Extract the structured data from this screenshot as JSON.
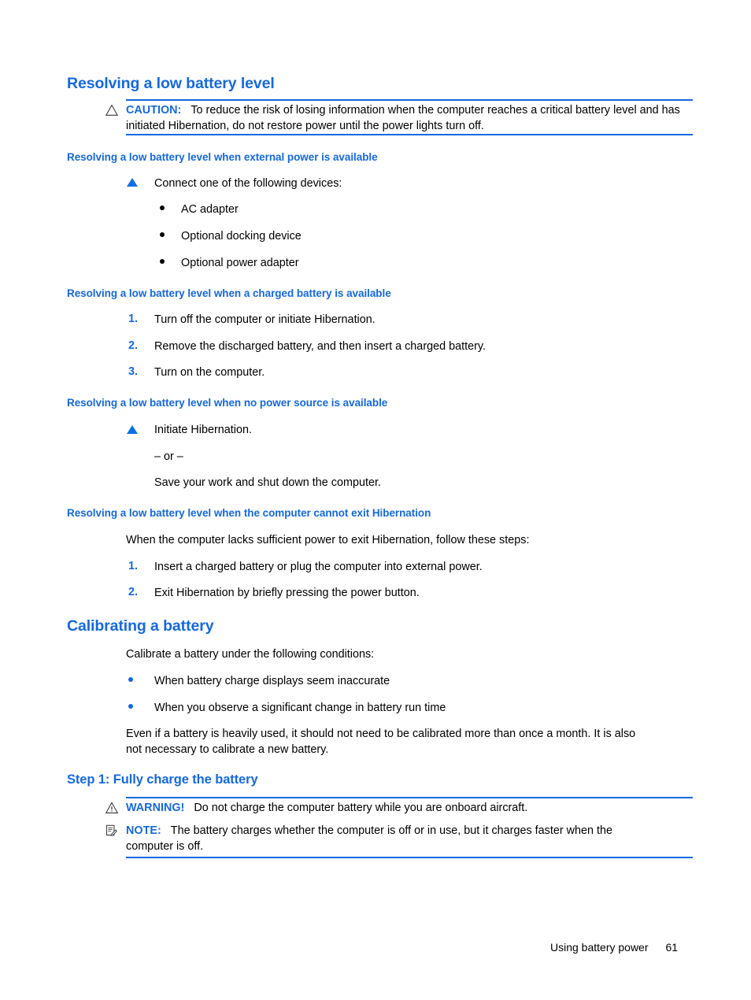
{
  "document": {
    "section_heading": "Resolving a low battery level",
    "caution": {
      "icon": "caution-triangle-icon",
      "label": "CAUTION:",
      "text": "To reduce the risk of losing information when the computer reaches a critical battery level and has initiated Hibernation, do not restore power until the power lights turn off."
    },
    "subsections": [
      {
        "heading": "Resolving a low battery level when external power is available",
        "step_marker": "blue-triangle-bullet",
        "step_text": "Connect one of the following devices:",
        "bullets": [
          "AC adapter",
          "Optional docking device",
          "Optional power adapter"
        ]
      },
      {
        "heading": "Resolving a low battery level when a charged battery is available",
        "steps": [
          {
            "number": "1.",
            "text": "Turn off the computer or initiate Hibernation."
          },
          {
            "number": "2.",
            "text": "Remove the discharged battery, and then insert a charged battery."
          },
          {
            "number": "3.",
            "text": "Turn on the computer."
          }
        ]
      },
      {
        "heading": "Resolving a low battery level when no power source is available",
        "step_marker": "blue-triangle-bullet",
        "step_text": "Initiate Hibernation.",
        "or_separator": "– or –",
        "alternative_text": "Save your work and shut down the computer."
      },
      {
        "heading": "Resolving a low battery level when the computer cannot exit Hibernation",
        "intro": "When the computer lacks sufficient power to exit Hibernation, follow these steps:",
        "steps": [
          {
            "number": "1.",
            "text": "Insert a charged battery or plug the computer into external power."
          },
          {
            "number": "2.",
            "text": "Exit Hibernation by briefly pressing the power button."
          }
        ]
      }
    ],
    "calibrating": {
      "heading": "Calibrating a battery",
      "intro": "Calibrate a battery under the following conditions:",
      "bullets": [
        "When battery charge displays seem inaccurate",
        "When you observe a significant change in battery run time"
      ],
      "outro_line1": "Even if a battery is heavily used, it should not need to be calibrated more than once a month. It is also",
      "outro_line2": "not necessary to calibrate a new battery."
    },
    "step1": {
      "heading": "Step 1: Fully charge the battery",
      "warning": {
        "icon": "warning-triangle-icon",
        "label": "WARNING!",
        "text": "Do not charge the computer battery while you are onboard aircraft."
      },
      "note": {
        "icon": "note-page-pencil-icon",
        "label": "NOTE:",
        "text_line1": "The battery charges whether the computer is off or in use, but it charges faster when the",
        "text_line2": "computer is off."
      }
    },
    "footer": {
      "chapter": "Using battery power",
      "page_number": "61"
    },
    "colors": {
      "heading_blue": "#1569e0",
      "marker_blue": "#0b6ee8",
      "rule_blue": "#1569e0",
      "body_black": "#000000",
      "page_background": "#ffffff"
    }
  }
}
